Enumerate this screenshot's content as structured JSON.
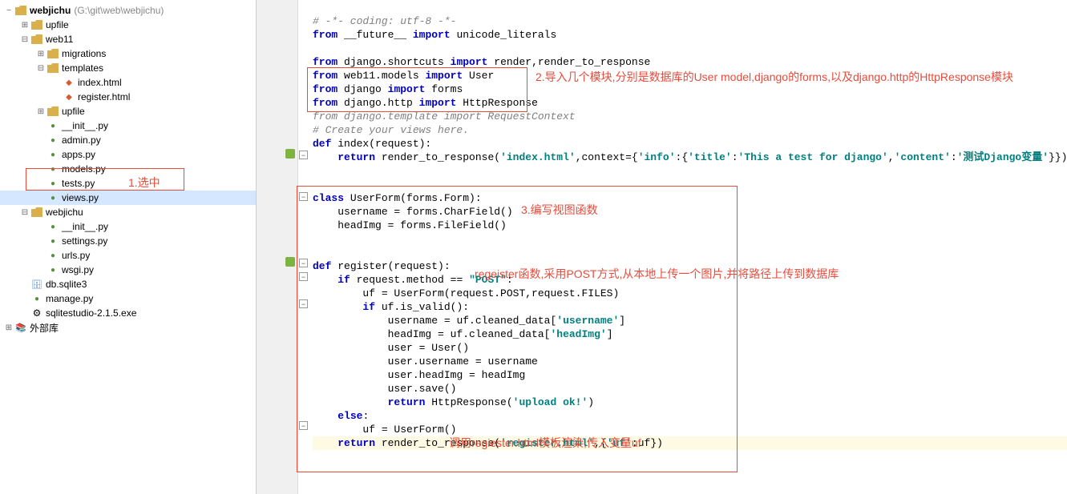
{
  "tree": {
    "root": {
      "label": "webjichu",
      "hint": "(G:\\git\\web\\webjichu)"
    },
    "items": [
      {
        "label": "upfile",
        "type": "folder",
        "indent": 20,
        "exp": "+"
      },
      {
        "label": "web11",
        "type": "folder",
        "indent": 20,
        "exp": "-"
      },
      {
        "label": "migrations",
        "type": "folder",
        "indent": 40,
        "exp": "+"
      },
      {
        "label": "templates",
        "type": "folder",
        "indent": 40,
        "exp": "-"
      },
      {
        "label": "index.html",
        "type": "html",
        "indent": 60,
        "exp": ""
      },
      {
        "label": "register.html",
        "type": "html",
        "indent": 60,
        "exp": ""
      },
      {
        "label": "upfile",
        "type": "folder",
        "indent": 40,
        "exp": "+"
      },
      {
        "label": "__init__.py",
        "type": "py",
        "indent": 40,
        "exp": ""
      },
      {
        "label": "admin.py",
        "type": "py",
        "indent": 40,
        "exp": ""
      },
      {
        "label": "apps.py",
        "type": "py",
        "indent": 40,
        "exp": ""
      },
      {
        "label": "models.py",
        "type": "py",
        "indent": 40,
        "exp": ""
      },
      {
        "label": "tests.py",
        "type": "py",
        "indent": 40,
        "exp": ""
      },
      {
        "label": "views.py",
        "type": "py",
        "indent": 40,
        "exp": "",
        "selected": true
      },
      {
        "label": "webjichu",
        "type": "folder",
        "indent": 20,
        "exp": "-"
      },
      {
        "label": "__init__.py",
        "type": "py",
        "indent": 40,
        "exp": ""
      },
      {
        "label": "settings.py",
        "type": "py",
        "indent": 40,
        "exp": ""
      },
      {
        "label": "urls.py",
        "type": "py",
        "indent": 40,
        "exp": ""
      },
      {
        "label": "wsgi.py",
        "type": "py",
        "indent": 40,
        "exp": ""
      },
      {
        "label": "db.sqlite3",
        "type": "db",
        "indent": 20,
        "exp": ""
      },
      {
        "label": "manage.py",
        "type": "py",
        "indent": 20,
        "exp": ""
      },
      {
        "label": "sqlitestudio-2.1.5.exe",
        "type": "exe",
        "indent": 20,
        "exp": ""
      },
      {
        "label": "外部库",
        "type": "lib",
        "indent": 0,
        "exp": "+"
      }
    ]
  },
  "annotations": {
    "a1": "1.选中",
    "a2": "2.导入几个模块,分别是数据库的User model,django的forms,以及django.http的HttpResponse模块",
    "a3": "3.编写视图函数",
    "a4": "regeister函数,采用POST方式,从本地上传一个图片,并将路径上传到数据库",
    "a5": "调用regiester.html模板渲染,传入变量uf"
  },
  "code": {
    "l1_c": "# -*- coding: utf-8 -*-",
    "l2_k1": "from",
    "l2_t1": " __future__ ",
    "l2_k2": "import",
    "l2_t2": " unicode_literals",
    "l4_k1": "from",
    "l4_t1": " django.shortcuts ",
    "l4_k2": "import",
    "l4_t2": " render,render_to_response",
    "l5_k1": "from",
    "l5_t1": " web11.models ",
    "l5_k2": "import",
    "l5_t2": " User",
    "l6_k1": "from",
    "l6_t1": " django ",
    "l6_k2": "import",
    "l6_t2": " forms",
    "l7_k1": "from",
    "l7_t1": " django.http ",
    "l7_k2": "import",
    "l7_t2": " HttpResponse",
    "l8_c": "from django.template import RequestContext",
    "l9_c": "# Create your views here.",
    "l10_k1": "def ",
    "l10_t1": "index(request):",
    "l11_k1": "return ",
    "l11_t1": "render_to_response(",
    "l11_s1": "'index.html'",
    "l11_t2": ",context={",
    "l11_s2": "'info'",
    "l11_t3": ":{",
    "l11_s3": "'title'",
    "l11_t4": ":",
    "l11_s4": "'This a test for django'",
    "l11_t5": ",",
    "l11_s5": "'content'",
    "l11_t6": ":",
    "l11_s6": "'测试Django变量'",
    "l11_t7": "}})",
    "l13_k1": "class ",
    "l13_t1": "UserForm(forms.Form):",
    "l14_t": "username = forms.CharField()",
    "l15_t": "headImg = forms.FileField()",
    "l17_k1": "def ",
    "l17_t1": "register(request):",
    "l18_k1": "if ",
    "l18_t1": "request.method == ",
    "l18_s1": "\"POST\"",
    "l18_t2": ":",
    "l19_t": "uf = UserForm(request.POST,request.FILES)",
    "l20_k1": "if ",
    "l20_t1": "uf.is_valid():",
    "l21_t1": "username = uf.cleaned_data[",
    "l21_s1": "'username'",
    "l21_t2": "]",
    "l22_t1": "headImg = uf.cleaned_data[",
    "l22_s1": "'headImg'",
    "l22_t2": "]",
    "l23_t": "user = User()",
    "l24_t": "user.username = username",
    "l25_t": "user.headImg = headImg",
    "l26_t": "user.save()",
    "l27_k1": "return ",
    "l27_t1": "HttpResponse(",
    "l27_s1": "'upload ok!'",
    "l27_t2": ")",
    "l28_k1": "else",
    "l28_t1": ":",
    "l29_t": "uf = UserForm()",
    "l30_k1": "return ",
    "l30_t1": "render_to_response(",
    "l30_s1": "'register.html'",
    "l30_t2": ",{",
    "l30_s2": "'uf'",
    "l30_t3": ":uf})"
  }
}
